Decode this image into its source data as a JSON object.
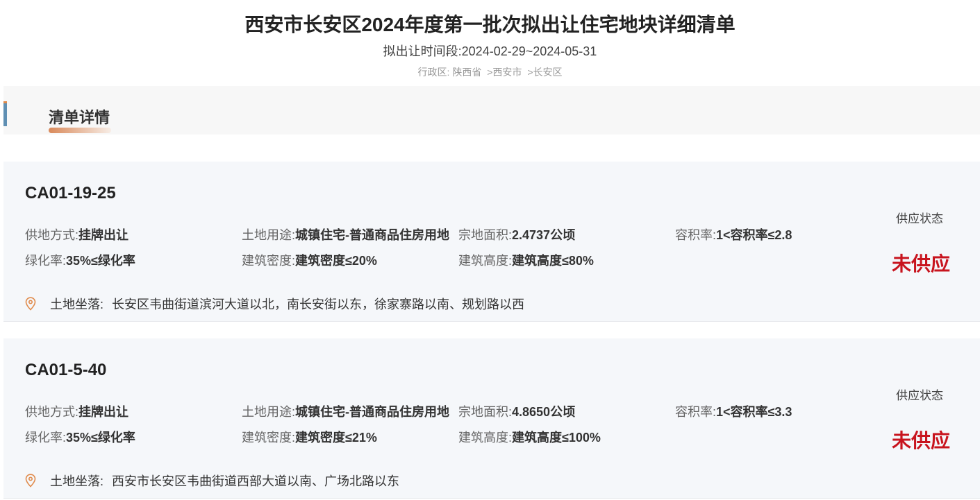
{
  "header": {
    "title": "西安市长安区2024年度第一批次拟出让住宅地块详细清单",
    "period": "拟出让时间段:2024-02-29~2024-05-31",
    "breadcrumb": [
      "行政区:",
      "陕西省",
      ">西安市",
      ">长安区"
    ]
  },
  "section": {
    "title": "清单详情"
  },
  "labels": {
    "supply_method": "供地方式:",
    "land_use": "土地用途:",
    "parcel_area": "宗地面积:",
    "plot_ratio": "容积率:",
    "green_rate": "绿化率:",
    "building_density": "建筑密度:",
    "building_height": "建筑高度:",
    "location": "土地坐落:",
    "status": "供应状态"
  },
  "parcels": [
    {
      "code": "CA01-19-25",
      "supply_method": "挂牌出让",
      "land_use": "城镇住宅-普通商品住房用地",
      "parcel_area": "2.4737公顷",
      "plot_ratio": "1<容积率≤2.8",
      "green_rate": "35%≤绿化率",
      "building_density": "建筑密度≤20%",
      "building_height": "建筑高度≤80%",
      "location": "长安区韦曲街道滨河大道以北，南长安街以东，徐家寨路以南、规划路以西",
      "status": "未供应"
    },
    {
      "code": "CA01-5-40",
      "supply_method": "挂牌出让",
      "land_use": "城镇住宅-普通商品住房用地",
      "parcel_area": "4.8650公顷",
      "plot_ratio": "1<容积率≤3.3",
      "green_rate": "35%≤绿化率",
      "building_density": "建筑密度≤21%",
      "building_height": "建筑高度≤100%",
      "location": "西安市长安区韦曲街道西部大道以南、广场北路以东",
      "status": "未供应"
    }
  ],
  "colors": {
    "status": "#c8141e",
    "accent": "#e08a4a",
    "bar": "#5f8fb3"
  },
  "icons": {
    "location": "map-pin-icon"
  }
}
